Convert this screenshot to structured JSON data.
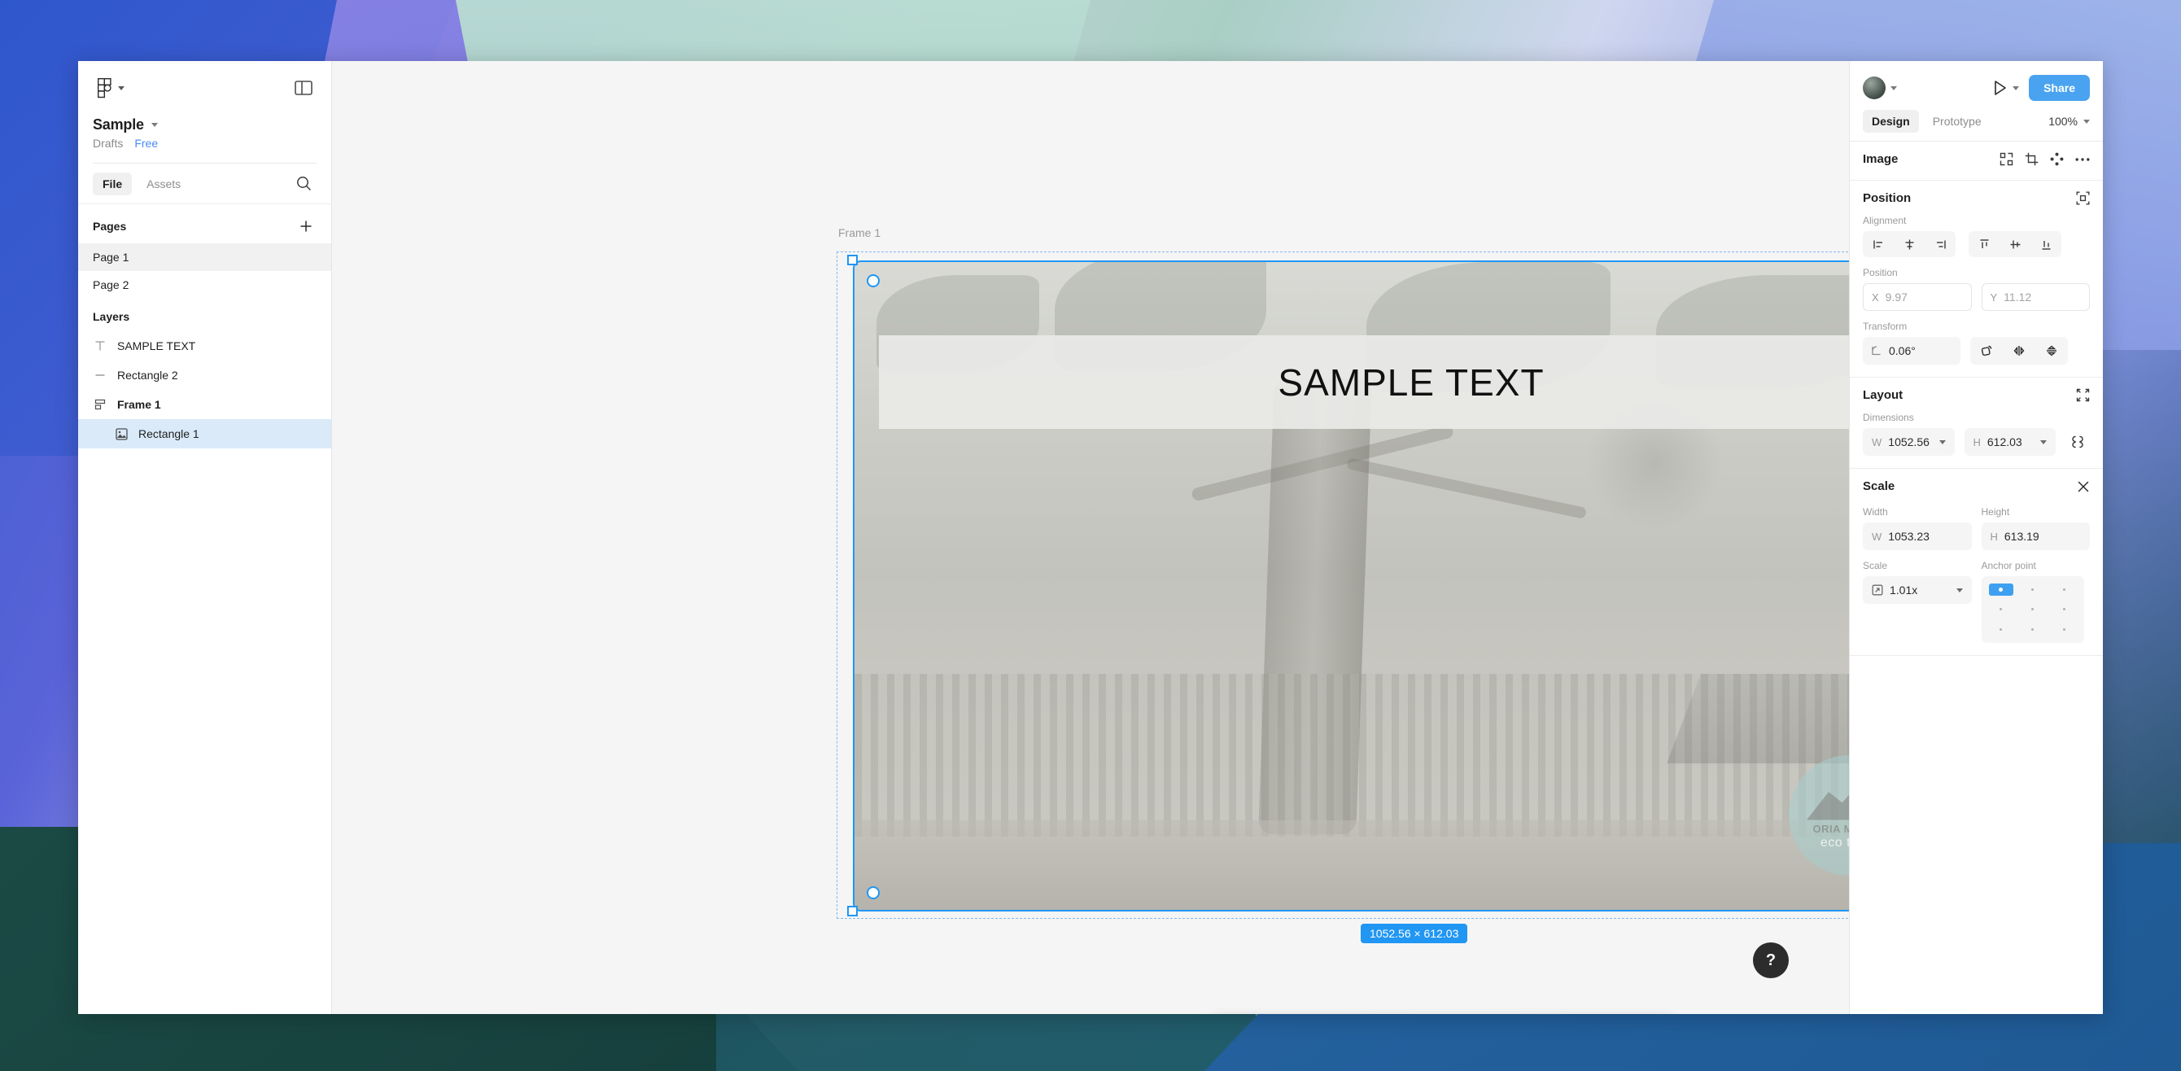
{
  "app": {
    "file_name": "Sample",
    "location": "Drafts",
    "plan": "Free"
  },
  "sidebar": {
    "tabs": [
      {
        "label": "File",
        "active": true
      },
      {
        "label": "Assets",
        "active": false
      }
    ],
    "search_icon": "search-icon",
    "pages_section": "Pages",
    "add_page_icon": "plus-icon",
    "pages": [
      {
        "label": "Page 1",
        "active": true
      },
      {
        "label": "Page 2",
        "active": false
      }
    ],
    "layers_section": "Layers",
    "layers": [
      {
        "label": "SAMPLE TEXT",
        "icon": "text-layer-icon",
        "selected": false,
        "indent": false,
        "bold": false
      },
      {
        "label": "Rectangle 2",
        "icon": "line-layer-icon",
        "selected": false,
        "indent": false,
        "bold": false
      },
      {
        "label": "Frame 1",
        "icon": "frame-layer-icon",
        "selected": false,
        "indent": false,
        "bold": true
      },
      {
        "label": "Rectangle 1",
        "icon": "image-layer-icon",
        "selected": true,
        "indent": true,
        "bold": false
      }
    ]
  },
  "canvas": {
    "frame_label": "Frame 1",
    "artboard_text": "SAMPLE TEXT",
    "dimension_badge": "1052.56 × 612.03",
    "watermark": {
      "line1": "ORIA MASAO",
      "line2": "eco tours"
    }
  },
  "toolbar": {
    "items": [
      {
        "name": "scale-tool",
        "icon": "scale-icon",
        "active": true,
        "has_caret": true
      },
      {
        "name": "frame-tool",
        "icon": "frame-icon",
        "active": false,
        "has_caret": true
      },
      {
        "name": "shape-tool",
        "icon": "rectangle-icon",
        "active": false,
        "has_caret": true
      },
      {
        "name": "pen-tool",
        "icon": "pen-icon",
        "active": false,
        "has_caret": true
      },
      {
        "name": "text-tool",
        "icon": "text-icon",
        "active": false,
        "has_caret": false
      },
      {
        "name": "comment-tool",
        "icon": "comment-icon",
        "active": false,
        "has_caret": false
      },
      {
        "name": "components-tool",
        "icon": "components-icon",
        "active": false,
        "has_caret": false
      },
      {
        "name": "dev-mode",
        "icon": "code-icon",
        "active": false,
        "has_caret": false
      }
    ]
  },
  "help": {
    "label": "?"
  },
  "right_panel": {
    "share_label": "Share",
    "present_icon": "play-icon",
    "tabs": [
      {
        "label": "Design",
        "active": true
      },
      {
        "label": "Prototype",
        "active": false
      }
    ],
    "zoom_level": "100%",
    "image_section": {
      "title": "Image",
      "icons": [
        "grid-icon",
        "crop-icon",
        "vector-icon",
        "more-icon"
      ]
    },
    "position_section": {
      "title": "Position",
      "absolute_icon": "absolute-position-icon",
      "alignment_label": "Alignment",
      "alignment_icons": [
        "align-left-icon",
        "align-horizontal-center-icon",
        "align-right-icon",
        "align-top-icon",
        "align-vertical-center-icon",
        "align-bottom-icon"
      ],
      "position_label": "Position",
      "x_key": "X",
      "x_value": "9.97",
      "y_key": "Y",
      "y_value": "11.12",
      "transform_label": "Transform",
      "rotation_value": "0.06°",
      "transform_icons": [
        "corner-radius-icon",
        "flip-horizontal-icon",
        "flip-vertical-icon"
      ]
    },
    "layout_section": {
      "title": "Layout",
      "collapse_icon": "resize-icon",
      "dimensions_label": "Dimensions",
      "w_key": "W",
      "w_value": "1052.56",
      "h_key": "H",
      "h_value": "612.03",
      "link_icon": "constrain-proportions-icon"
    },
    "scale_section": {
      "title": "Scale",
      "close_icon": "close-icon",
      "width_label": "Width",
      "height_label": "Height",
      "w_key": "W",
      "w_value": "1053.23",
      "h_key": "H",
      "h_value": "613.19",
      "scale_label": "Scale",
      "scale_icon": "scale-icon",
      "scale_value": "1.01x",
      "anchor_label": "Anchor point",
      "anchor_selected": "top-left"
    }
  },
  "colors": {
    "accent_blue": "#4aa3f0",
    "selection_blue": "#2196f3",
    "layer_selected_bg": "#daeaf9",
    "link_blue": "#4a8af4"
  }
}
